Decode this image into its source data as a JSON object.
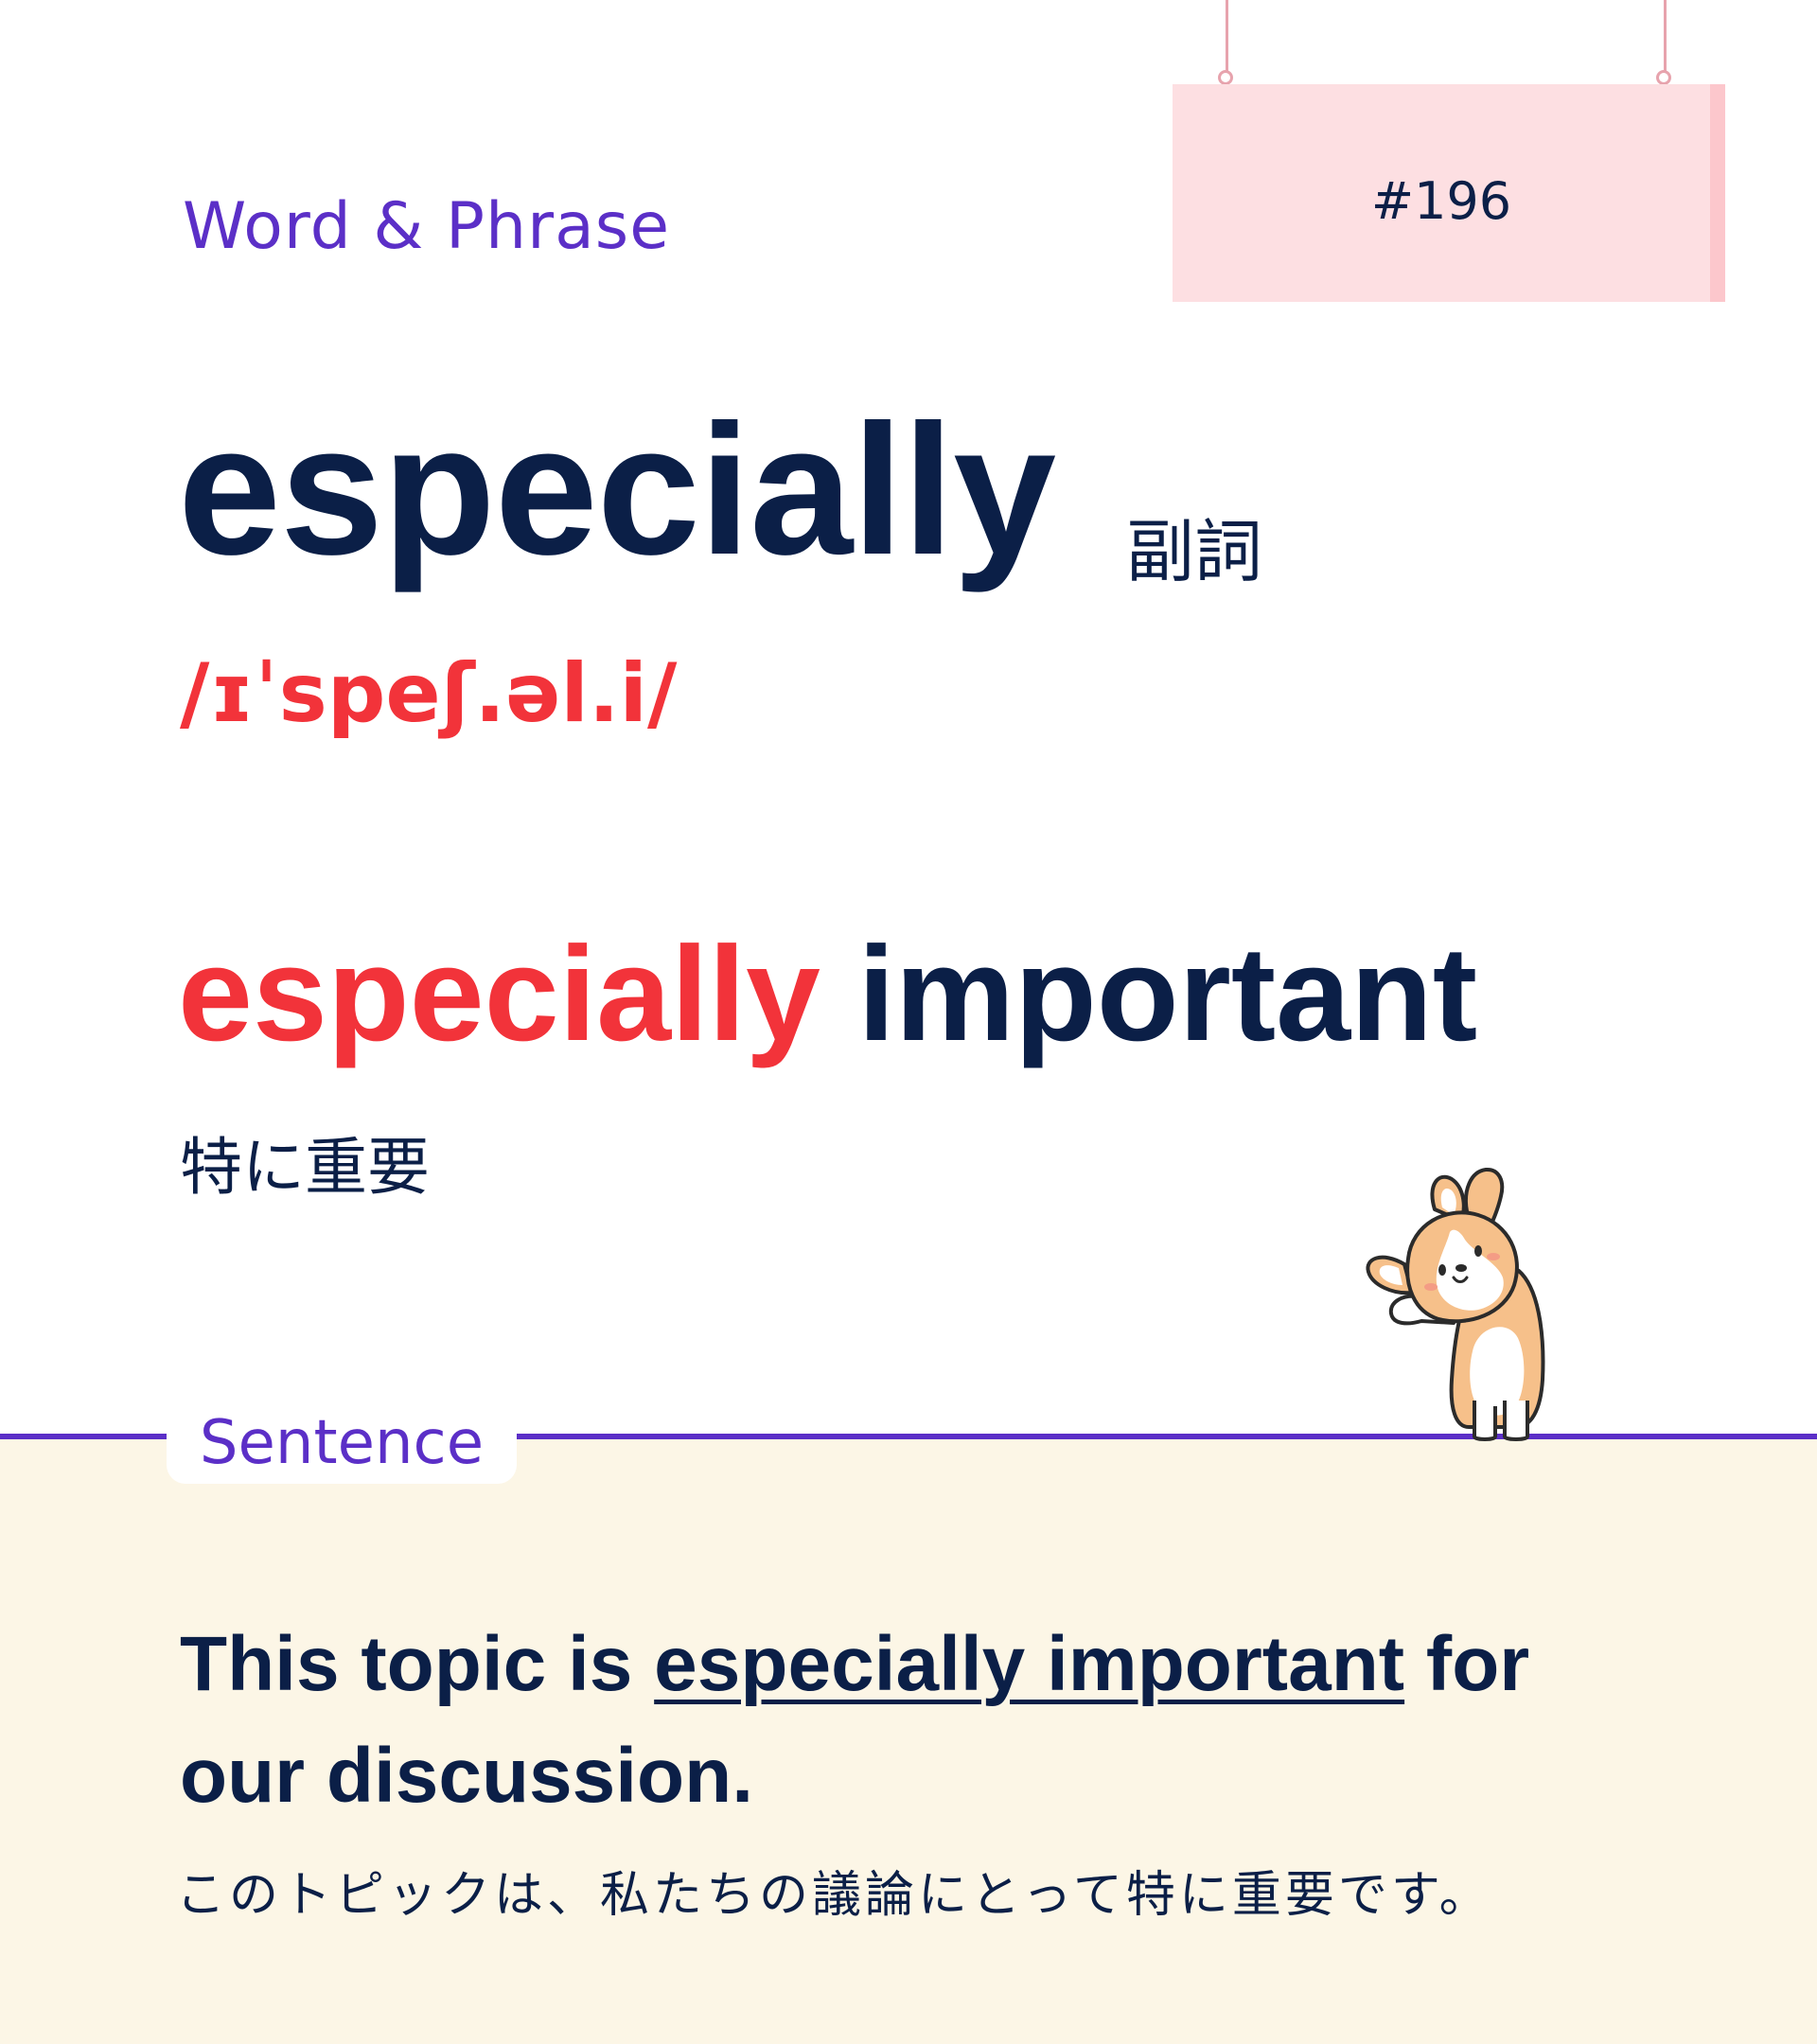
{
  "header": {
    "category": "Word & Phrase",
    "number": "#196"
  },
  "entry": {
    "word": "especially",
    "part_of_speech": "副詞",
    "pronunciation": "/ɪˈspeʃ.əl.i/"
  },
  "collocation": {
    "highlight": "especially",
    "rest": " important",
    "translation": "特に重要"
  },
  "sentence_section": {
    "label": "Sentence",
    "sentence_before": "This topic is ",
    "sentence_highlight": "especially important",
    "sentence_after": " for our discussion.",
    "translation": "このトピックは、私たちの議論にとって特に重要です。"
  },
  "colors": {
    "navy": "#0b1f47",
    "accent_red": "#f2333a",
    "purple": "#5b2fc7",
    "sign_pink": "#fddfe2",
    "sentence_bg": "#fcf6e6"
  },
  "icons": {
    "mascot": "corgi-mascot-icon"
  }
}
